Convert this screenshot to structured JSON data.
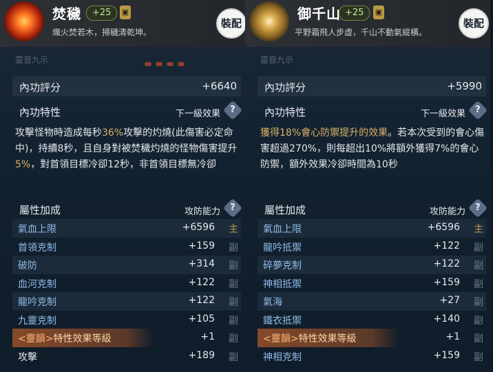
{
  "left": {
    "header": {
      "name": "焚穢",
      "level": "+25",
      "lock_icon": "lock-icon",
      "motto": "熾火焚若木，掃穢清乾坤。",
      "equip_label": "裝配"
    },
    "cut_text": "靈音九示",
    "score": {
      "label": "內功評分",
      "value": "+6640"
    },
    "trait": {
      "label": "內功特性",
      "next_label": "下一級效果",
      "desc_parts": [
        "攻擊怪物時造成每秒",
        "36%",
        "攻擊的灼燒(此傷害必定命中)，持續8秒，且自身對被焚穢灼燒的怪物傷害提升",
        "5%",
        "，對首領目標冷卻12秒，非首領目標無冷卻"
      ]
    },
    "attr_header": {
      "label": "屬性加成",
      "right": "攻防能力"
    },
    "attrs": [
      {
        "name": "氣血上限",
        "value": "+6596",
        "tag": "主"
      },
      {
        "name": "首領克制",
        "value": "+159",
        "tag": "副"
      },
      {
        "name": "破防",
        "value": "+314",
        "tag": "副"
      },
      {
        "name": "血河克制",
        "value": "+122",
        "tag": "副"
      },
      {
        "name": "龍吟克制",
        "value": "+122",
        "tag": "副"
      },
      {
        "name": "九靈克制",
        "value": "+105",
        "tag": "副"
      },
      {
        "name": "特性效果等級",
        "prefix": "<靈韻>",
        "value": "+1",
        "tag": "副"
      },
      {
        "name": "攻擊",
        "value": "+189",
        "tag": "副"
      }
    ]
  },
  "right": {
    "header": {
      "name": "御千山",
      "level": "+25",
      "lock_icon": "lock-icon",
      "motto": "平野霜飛人步虛，千山不動氣縱橫。",
      "equip_label": "裝配"
    },
    "cut_text": "靈音九示",
    "score": {
      "label": "內功評分",
      "value": "+5990"
    },
    "trait": {
      "label": "內功特性",
      "next_label": "下一級效果",
      "desc_parts": [
        "獲得18%會心防禦提升的效果",
        "。若本次受到的會心傷害超過270%，則每超出10%將額外獲得7%的會心防禦",
        "，額外效果冷卻時間為10秒"
      ]
    },
    "attr_header": {
      "label": "屬性加成",
      "right": "攻防能力"
    },
    "attrs": [
      {
        "name": "氣血上限",
        "value": "+6596",
        "tag": "主"
      },
      {
        "name": "龍吟抵禦",
        "value": "+122",
        "tag": "副"
      },
      {
        "name": "碎夢克制",
        "value": "+122",
        "tag": "副"
      },
      {
        "name": "神相抵禦",
        "value": "+159",
        "tag": "副"
      },
      {
        "name": "氣海",
        "value": "+27",
        "tag": "副"
      },
      {
        "name": "鐵衣抵禦",
        "value": "+140",
        "tag": "副"
      },
      {
        "name": "特性效果等級",
        "prefix": "<靈韻>",
        "value": "+1",
        "tag": "副"
      },
      {
        "name": "神相克制",
        "value": "+159",
        "tag": "副"
      }
    ]
  },
  "help_icon": "question-icon"
}
